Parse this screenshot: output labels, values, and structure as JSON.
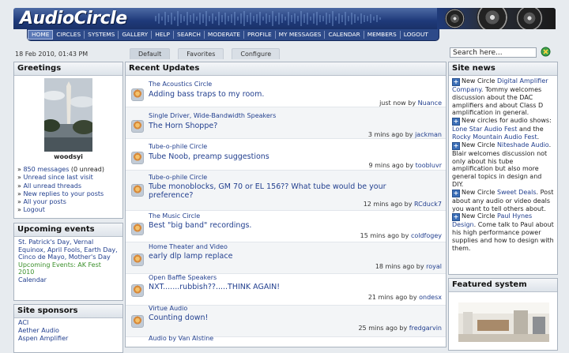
{
  "header": {
    "logo": "AudioCircle",
    "nav": [
      "HOME",
      "CIRCLES",
      "SYSTEMS",
      "GALLERY",
      "HELP",
      "SEARCH",
      "MODERATE",
      "PROFILE",
      "MY MESSAGES",
      "CALENDAR",
      "MEMBERS",
      "LOGOUT"
    ]
  },
  "datetime": "18 Feb 2010, 01:43 PM",
  "tabs": [
    "Default",
    "Favorites",
    "Configure"
  ],
  "search": {
    "value": "Search here..."
  },
  "greetings": {
    "title": "Greetings",
    "username": "woodsyi",
    "messages_count": "850 messages",
    "unread": "(0 unread)",
    "links": [
      "Unread since last visit",
      "All unread threads",
      "New replies to your posts",
      "All your posts",
      "Logout"
    ]
  },
  "upcoming": {
    "title": "Upcoming events",
    "holidays": "St. Patrick's Day, Vernal Equinox, April Fools, Earth Day, Cinco de Mayo, Mother's Day",
    "events": "Upcoming Events: AK Fest 2010",
    "calendar": "Calendar"
  },
  "sponsors": {
    "title": "Site sponsors",
    "items": [
      "ACI",
      "Aether Audio",
      "Aspen Amplifier"
    ]
  },
  "recent": {
    "title": "Recent Updates",
    "rows": [
      {
        "circle": "The Acoustics Circle",
        "topic": "Adding bass traps to my room.",
        "time": "just now by",
        "user": "Nuance"
      },
      {
        "circle": "Single Driver, Wide-Bandwidth Speakers",
        "topic": "The Horn Shoppe?",
        "time": "3 mins ago by",
        "user": "jackman"
      },
      {
        "circle": "Tube-o-phile Circle",
        "topic": "Tube Noob, preamp suggestions",
        "time": "9 mins ago by",
        "user": "toobluvr"
      },
      {
        "circle": "Tube-o-phile Circle",
        "topic": "Tube monoblocks, GM 70 or EL 156?? What tube would be your preference?",
        "time": "12 mins ago by",
        "user": "RCduck7"
      },
      {
        "circle": "The Music Circle",
        "topic": "Best \"big band\" recordings.",
        "time": "15 mins ago by",
        "user": "coldfogey"
      },
      {
        "circle": "Home Theater and Video",
        "topic": "early dlp lamp replace",
        "time": "18 mins ago by",
        "user": "royal"
      },
      {
        "circle": "Open Baffle Speakers",
        "topic": "NXT.......rubbish??.....THINK AGAIN!",
        "time": "21 mins ago by",
        "user": "ondesx"
      },
      {
        "circle": "Virtue Audio",
        "topic": "Counting down!",
        "time": "25 mins ago by",
        "user": "fredgarvin"
      },
      {
        "circle": "Audio by Van Alstine",
        "topic": "",
        "time": "",
        "user": ""
      }
    ]
  },
  "sitenews": {
    "title": "Site news",
    "items": [
      {
        "prefix": "New Circle",
        "link": "Digital Amplifier Company",
        "text": ". Tommy welcomes discussion about the DAC amplifiers and about Class D amplification in general."
      },
      {
        "prefix": "New circles for audio shows:",
        "link": "Lone Star Audio Fest",
        "text": " and the ",
        "link2": "Rocky Mountain Audio Fest",
        "text2": "."
      },
      {
        "prefix": "New Circle",
        "link": "Niteshade Audio",
        "text": ". Blair welcomes discussion not only about his tube amplification but also more general topics in design and DIY."
      },
      {
        "prefix": "New Circle",
        "link": "Sweet Deals",
        "text": ". Post about any audio or video deals you want to tell others about."
      },
      {
        "prefix": "New Circle",
        "link": "Paul Hynes Design",
        "text": ". Come talk to Paul about his high performance power supplies and how to design with them."
      }
    ]
  },
  "featured": {
    "title": "Featured system"
  },
  "colors": {
    "header_blue": "#1f3a7a",
    "link": "#23408f",
    "panel_bg": "#ffffff"
  }
}
